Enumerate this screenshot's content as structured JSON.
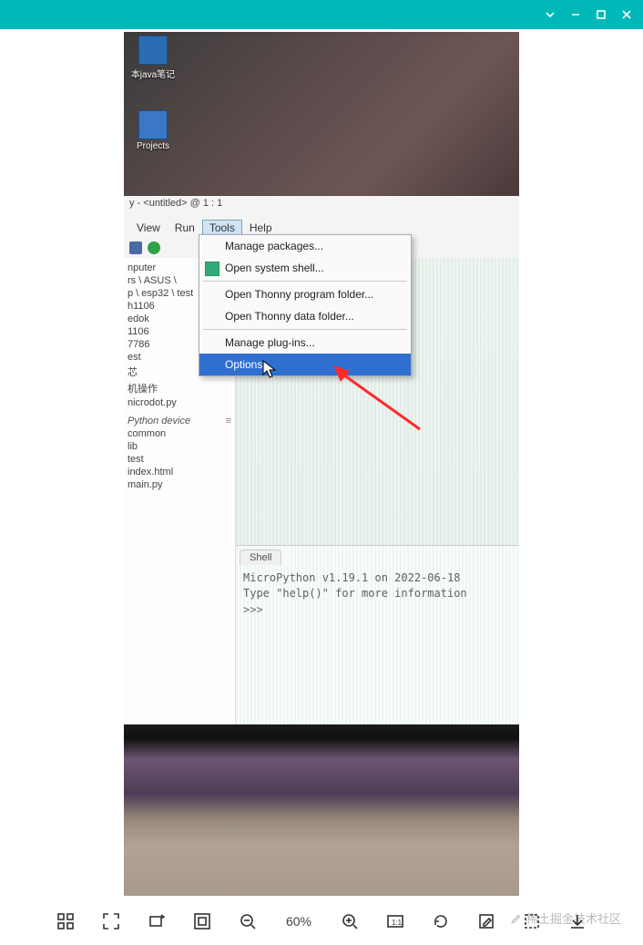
{
  "viewer": {
    "zoom_label": "60%"
  },
  "desktop": {
    "icon1_label": "本java笔记",
    "icon2_label": "Projects"
  },
  "thonny": {
    "title": "y - <untitled>  @  1 : 1",
    "menubar": {
      "view": "View",
      "run": "Run",
      "tools": "Tools",
      "help": "Help"
    },
    "tools_menu": {
      "manage_packages": "Manage packages...",
      "open_shell": "Open system shell...",
      "open_prog_folder": "Open Thonny program folder...",
      "open_data_folder": "Open Thonny data folder...",
      "manage_plugins": "Manage plug-ins...",
      "options": "Options..."
    },
    "files": {
      "header1": "nputer",
      "header2": "rs \\ ASUS \\",
      "header3": "p \\ esp32 \\ test",
      "items1": [
        "h1106",
        "edok",
        "1106",
        "7786",
        "est",
        "芯",
        "机操作",
        "nicrodot.py"
      ],
      "section2": "Python device",
      "items2": [
        "common",
        "lib",
        "test",
        "index.html",
        "main.py"
      ]
    },
    "shell": {
      "tab": "Shell",
      "line1": "MicroPython v1.19.1 on 2022-06-18",
      "line2": "Type \"help()\" for more information",
      "prompt": ">>> "
    }
  },
  "watermark": "稀土掘金技术社区"
}
